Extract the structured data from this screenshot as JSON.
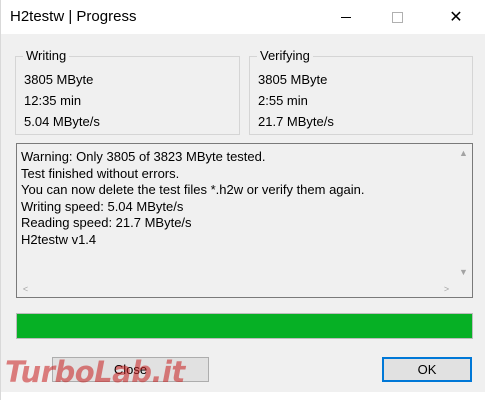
{
  "window": {
    "title": "H2testw | Progress",
    "controls": {
      "minimize": "minimize-icon",
      "maximize": "maximize-icon",
      "close": "close-icon",
      "close_glyph": "✕"
    }
  },
  "writing": {
    "label": "Writing",
    "size": "3805 MByte",
    "time": "12:35 min",
    "speed": "5.04 MByte/s"
  },
  "verifying": {
    "label": "Verifying",
    "size": "3805 MByte",
    "time": "2:55 min",
    "speed": "21.7 MByte/s"
  },
  "log": {
    "lines": [
      "Warning: Only 3805 of 3823 MByte tested.",
      "Test finished without errors.",
      "You can now delete the test files *.h2w or verify them again.",
      "Writing speed: 5.04 MByte/s",
      "Reading speed: 21.7 MByte/s",
      "H2testw v1.4"
    ]
  },
  "scrollbar": {
    "up_arrow": "▲",
    "down_arrow": "▼",
    "left_arrow": "<",
    "right_arrow": ">"
  },
  "progress": {
    "percent": 100,
    "fill_color": "#06b025"
  },
  "buttons": {
    "close_label": "Close",
    "ok_label": "OK"
  },
  "watermark": {
    "text": "TurboLab.it"
  },
  "colors": {
    "accent": "#0078d7"
  }
}
